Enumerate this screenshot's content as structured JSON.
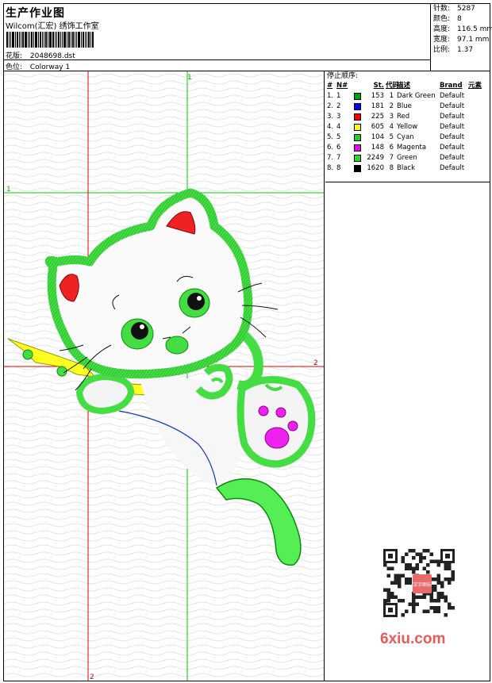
{
  "header": {
    "title": "生产作业图",
    "subtitle": "Wilcom(汇宏) 绣饰工作室",
    "design_label": "花版:",
    "design_value": "2048698.dst",
    "colorway_label": "色位:",
    "colorway_value": "Colorway 1"
  },
  "stats": {
    "stitches_label": "针数:",
    "stitches_value": "5287",
    "colors_label": "颜色:",
    "colors_value": "8",
    "height_label": "高度:",
    "height_value": "116.5 mm",
    "width_label": "宽度:",
    "width_value": "97.1 mm",
    "scale_label": "比例:",
    "scale_value": "1.37"
  },
  "markers": {
    "green_top": "1",
    "green_left": "1",
    "red_right": "2",
    "red_bottom": "2"
  },
  "color_table": {
    "title": "停止顺序:",
    "headers": {
      "idx": "#",
      "n": "N#",
      "st": "St.",
      "code": "代码",
      "desc": "描述",
      "brand": "Brand",
      "elem": "元素"
    },
    "rows": [
      {
        "idx": "1.",
        "n": "1",
        "color": "#00a000",
        "st": "153",
        "code": "1",
        "desc": "Dark Green",
        "brand": "Default"
      },
      {
        "idx": "2.",
        "n": "2",
        "color": "#0000ff",
        "st": "181",
        "code": "2",
        "desc": "Blue",
        "brand": "Default"
      },
      {
        "idx": "3.",
        "n": "3",
        "color": "#ff0000",
        "st": "225",
        "code": "3",
        "desc": "Red",
        "brand": "Default"
      },
      {
        "idx": "4.",
        "n": "4",
        "color": "#ffff00",
        "st": "605",
        "code": "4",
        "desc": "Yellow",
        "brand": "Default"
      },
      {
        "idx": "5.",
        "n": "5",
        "color": "#22cc22",
        "st": "104",
        "code": "5",
        "desc": "Cyan",
        "brand": "Default"
      },
      {
        "idx": "6.",
        "n": "6",
        "color": "#ee00ee",
        "st": "148",
        "code": "6",
        "desc": "Magenta",
        "brand": "Default"
      },
      {
        "idx": "7.",
        "n": "7",
        "color": "#22dd22",
        "st": "2249",
        "code": "7",
        "desc": "Green",
        "brand": "Default"
      },
      {
        "idx": "8.",
        "n": "8",
        "color": "#000000",
        "st": "1620",
        "code": "8",
        "desc": "Black",
        "brand": "Default"
      }
    ]
  },
  "watermark": "6xiu.com",
  "qr_stamp": "汉字图标"
}
